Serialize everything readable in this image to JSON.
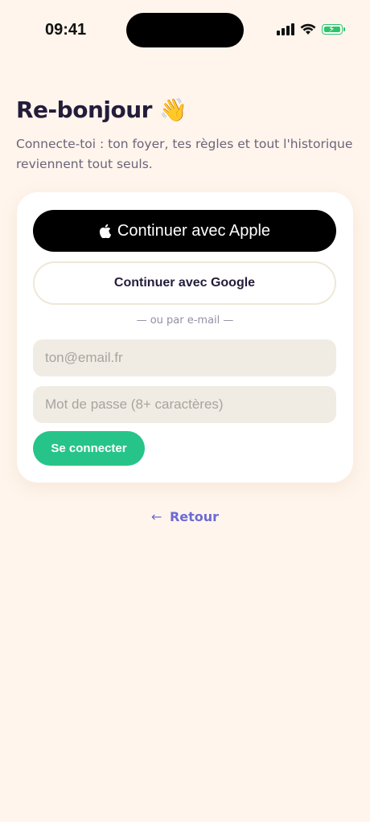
{
  "status_bar": {
    "time": "09:41"
  },
  "header": {
    "title": "Re-bonjour",
    "wave_emoji": "👋",
    "subtitle": "Connecte-toi : ton foyer, tes règles et tout l'historique reviennent tout seuls."
  },
  "auth": {
    "apple_label": "Continuer avec Apple",
    "google_label": "Continuer avec Google",
    "divider": "— ou par e-mail —",
    "email_placeholder": "ton@email.fr",
    "password_placeholder": "Mot de passe (8+ caractères)",
    "login_label": "Se connecter"
  },
  "back": {
    "arrow": "←",
    "label": "Retour"
  },
  "colors": {
    "background": "#FFF5EC",
    "primary_green": "#27C48A",
    "link_purple": "#6E6AD6",
    "title_dark": "#241C3A"
  },
  "icons": [
    "signal-icon",
    "wifi-icon",
    "battery-icon",
    "apple-icon",
    "back-arrow-icon"
  ]
}
